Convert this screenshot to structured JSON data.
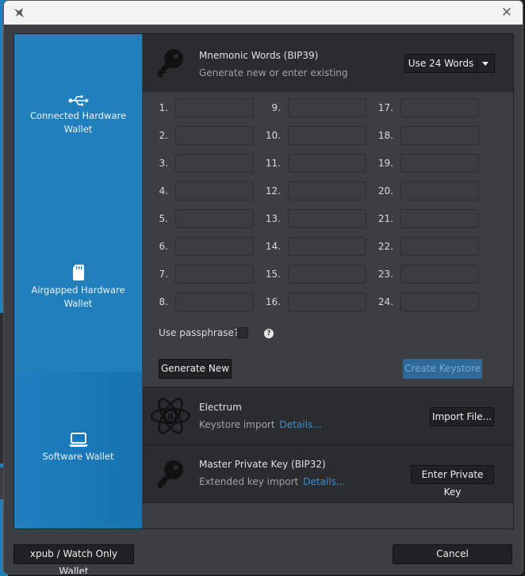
{
  "titlebar": {
    "close_glyph": "✕"
  },
  "sidebar": {
    "items": [
      {
        "label_line1": "Connected Hardware",
        "label_line2": "Wallet",
        "icon": "usb-icon"
      },
      {
        "label_line1": "Airgapped Hardware",
        "label_line2": "Wallet",
        "icon": "sd-card-icon"
      },
      {
        "label_line1": "Software Wallet",
        "label_line2": "",
        "icon": "laptop-icon",
        "selected": true
      }
    ]
  },
  "mnemonic": {
    "title": "Mnemonic Words (BIP39)",
    "subtitle": "Generate new or enter existing",
    "word_count_selected": "Use 24 Words",
    "word_numbers": [
      "1.",
      "2.",
      "3.",
      "4.",
      "5.",
      "6.",
      "7.",
      "8.",
      "9.",
      "10.",
      "11.",
      "12.",
      "13.",
      "14.",
      "15.",
      "16.",
      "17.",
      "18.",
      "19.",
      "20.",
      "21.",
      "22.",
      "23.",
      "24."
    ],
    "words": [
      "",
      "",
      "",
      "",
      "",
      "",
      "",
      "",
      "",
      "",
      "",
      "",
      "",
      "",
      "",
      "",
      "",
      "",
      "",
      "",
      "",
      "",
      "",
      ""
    ],
    "passphrase_label": "Use passphrase?",
    "passphrase_checked": false,
    "help_glyph": "?",
    "generate_label": "Generate New",
    "create_label": "Create Keystore"
  },
  "electrum": {
    "title": "Electrum",
    "subtitle": "Keystore import",
    "details_link": "Details...",
    "button_label": "Import File..."
  },
  "master_key": {
    "title": "Master Private Key (BIP32)",
    "subtitle": "Extended key import",
    "details_link": "Details...",
    "button_label": "Enter Private Key"
  },
  "footer": {
    "xpub_label": "xpub / Watch Only Wallet",
    "cancel_label": "Cancel"
  },
  "colors": {
    "accent": "#2180bc",
    "link": "#3a8ed3",
    "create_button": "#2d6a9a"
  }
}
